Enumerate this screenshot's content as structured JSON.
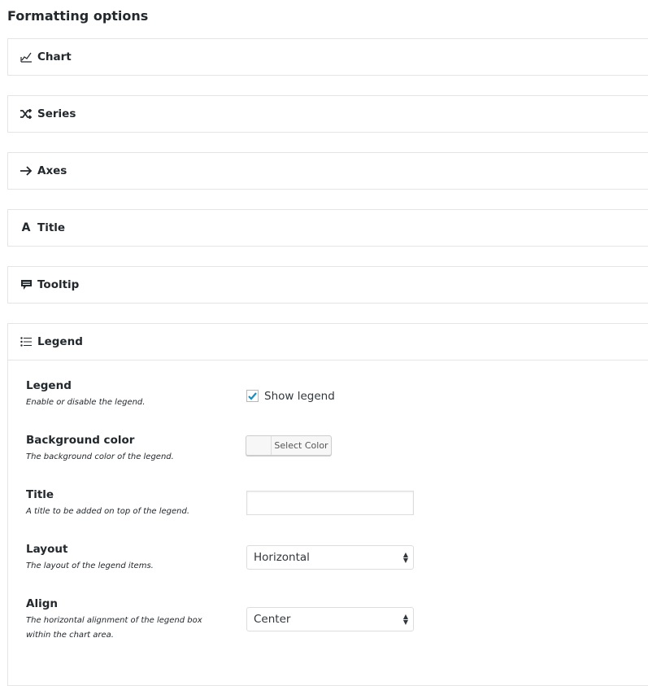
{
  "title": "Formatting options",
  "panels": [
    {
      "label": "Chart",
      "icon": "chart-line-icon"
    },
    {
      "label": "Series",
      "icon": "shuffle-icon"
    },
    {
      "label": "Axes",
      "icon": "arrow-right-icon"
    },
    {
      "label": "Title",
      "icon": "letter-a-icon"
    },
    {
      "label": "Tooltip",
      "icon": "speech-bubble-icon"
    },
    {
      "label": "Legend",
      "icon": "list-icon"
    }
  ],
  "legend": {
    "show": {
      "label": "Legend",
      "desc": "Enable or disable the legend.",
      "checkbox_label": "Show legend",
      "checked": true
    },
    "bg": {
      "label": "Background color",
      "desc": "The background color of the legend.",
      "button": "Select Color"
    },
    "title": {
      "label": "Title",
      "desc": "A title to be added on top of the legend.",
      "value": ""
    },
    "layout": {
      "label": "Layout",
      "desc": "The layout of the legend items.",
      "value": "Horizontal"
    },
    "align": {
      "label": "Align",
      "desc": "The horizontal alignment of the legend box within the chart area.",
      "value": "Center"
    }
  },
  "colors": {
    "check": "#1e8cbe",
    "border": "#e5e5e5"
  }
}
